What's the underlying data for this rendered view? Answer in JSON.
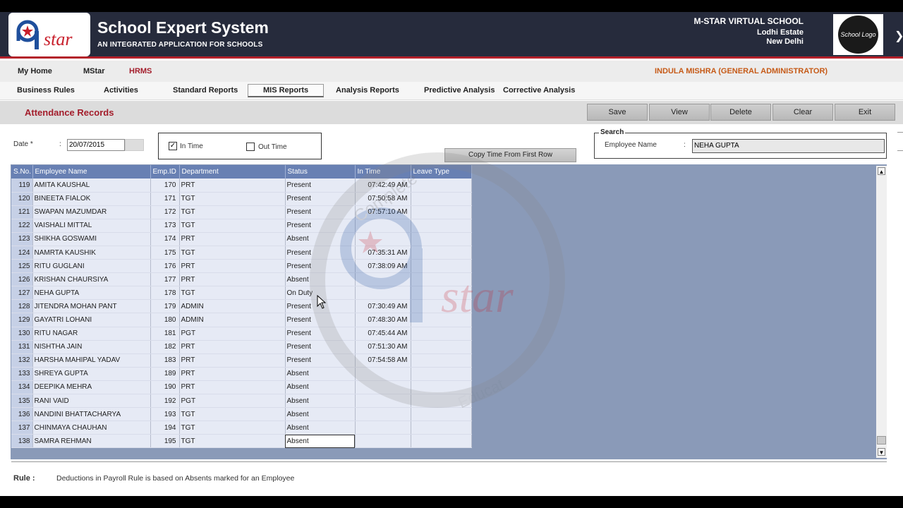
{
  "header": {
    "logo_text": "star",
    "app_title": "School Expert System",
    "app_subtitle": "AN INTEGRATED APPLICATION FOR SCHOOLS",
    "school_name": "M-STAR VIRTUAL SCHOOL",
    "school_address_1": "Lodhi Estate",
    "school_address_2": "New Delhi",
    "school_logo_text": "School Logo"
  },
  "nav_main": {
    "items": [
      "My Home",
      "MStar",
      "HRMS"
    ],
    "user": "INDULA MISHRA (GENERAL ADMINISTRATOR)"
  },
  "nav_sub": {
    "items": [
      "Business Rules",
      "Activities",
      "Standard Reports",
      "MIS Reports",
      "Analysis Reports",
      "Predictive Analysis",
      "Corrective Analysis"
    ],
    "active": "MIS Reports"
  },
  "page": {
    "title": "Attendance Records",
    "buttons": [
      "Save",
      "View",
      "Delete",
      "Clear",
      "Exit"
    ]
  },
  "form": {
    "date_label": "Date *",
    "colon": ":",
    "date_value": "20/07/2015",
    "in_time_label": "In Time",
    "in_time_checked": true,
    "out_time_label": "Out Time",
    "out_time_checked": false,
    "copy_button": "Copy Time From First Row",
    "search_legend": "Search",
    "employee_name_label": "Employee Name",
    "employee_name_value": "NEHA GUPTA"
  },
  "grid": {
    "columns": [
      "S.No.",
      "Employee Name",
      "Emp.ID",
      "Department",
      "Status",
      "In Time",
      "Leave Type"
    ],
    "rows": [
      [
        "119",
        "AMITA KAUSHAL",
        "170",
        "PRT",
        "Present",
        "07:42:49 AM",
        ""
      ],
      [
        "120",
        "BINEETA FIALOK",
        "171",
        "TGT",
        "Present",
        "07:50:58 AM",
        ""
      ],
      [
        "121",
        "SWAPAN MAZUMDAR",
        "172",
        "TGT",
        "Present",
        "07:57:10 AM",
        ""
      ],
      [
        "122",
        "VAISHALI MITTAL",
        "173",
        "TGT",
        "Present",
        "",
        ""
      ],
      [
        "123",
        "SHIKHA GOSWAMI",
        "174",
        "PRT",
        "Absent",
        "",
        ""
      ],
      [
        "124",
        "NAMRTA KAUSHIK",
        "175",
        "TGT",
        "Present",
        "07:35:31 AM",
        ""
      ],
      [
        "125",
        "RITU GUGLANI",
        "176",
        "PRT",
        "Present",
        "07:38:09 AM",
        ""
      ],
      [
        "126",
        "KRISHAN CHAURSIYA",
        "177",
        "PRT",
        "Absent",
        "",
        ""
      ],
      [
        "127",
        "NEHA GUPTA",
        "178",
        "TGT",
        "On Duty",
        "",
        ""
      ],
      [
        "128",
        "JITENDRA MOHAN PANT",
        "179",
        "ADMIN",
        "Present",
        "07:30:49 AM",
        ""
      ],
      [
        "129",
        "GAYATRI LOHANI",
        "180",
        "ADMIN",
        "Present",
        "07:48:30 AM",
        ""
      ],
      [
        "130",
        "RITU NAGAR",
        "181",
        "PGT",
        "Present",
        "07:45:44 AM",
        ""
      ],
      [
        "131",
        "NISHTHA JAIN",
        "182",
        "PRT",
        "Present",
        "07:51:30 AM",
        ""
      ],
      [
        "132",
        "HARSHA MAHIPAL YADAV",
        "183",
        "PRT",
        "Present",
        "07:54:58 AM",
        ""
      ],
      [
        "133",
        "SHREYA GUPTA",
        "189",
        "PRT",
        "Absent",
        "",
        ""
      ],
      [
        "134",
        "DEEPIKA MEHRA",
        "190",
        "PRT",
        "Absent",
        "",
        ""
      ],
      [
        "135",
        "RANI VAID",
        "192",
        "PGT",
        "Absent",
        "",
        ""
      ],
      [
        "136",
        "NANDINI BHATTACHARYA",
        "193",
        "TGT",
        "Absent",
        "",
        ""
      ],
      [
        "137",
        "CHINMAYA CHAUHAN",
        "194",
        "TGT",
        "Absent",
        "",
        ""
      ],
      [
        "138",
        "SAMRA REHMAN",
        "195",
        "TGT",
        "Absent",
        "",
        ""
      ]
    ]
  },
  "footer": {
    "rule_label": "Rule :",
    "rule_text": "Deductions in Payroll Rule is based on Absents marked for an Employee"
  },
  "watermark": {
    "ring_text": "Complete",
    "logo_text": "star",
    "bottom_text": "Educat"
  },
  "colors": {
    "header_bg": "#262b3c",
    "accent_red": "#a31d2b",
    "grid_header": "#6880b3",
    "grid_area": "#8a9ab8"
  }
}
